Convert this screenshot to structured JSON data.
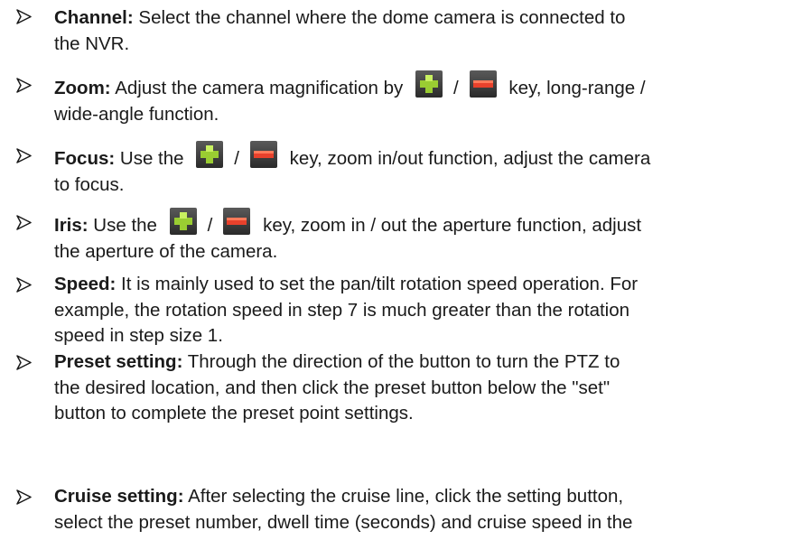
{
  "items": [
    {
      "label": "Channel:",
      "line1": " Select the channel where the dome camera is connected to",
      "line2": "the NVR."
    },
    {
      "label": "Zoom:",
      "pre": " Adjust the camera magnification by",
      "sep": "/",
      "post": "key, long-range /",
      "line2": "wide-angle function."
    },
    {
      "label": "Focus:",
      "pre": " Use the",
      "sep": "/",
      "post": "key, zoom in/out function, adjust the camera",
      "line2": "to focus."
    },
    {
      "label": "Iris:",
      "pre": " Use the",
      "sep": "/",
      "post": "key, zoom in / out the aperture function, adjust",
      "line2": "the aperture of the camera."
    },
    {
      "label": "Speed:",
      "line1": " It is mainly used to set the pan/tilt rotation speed operation. For",
      "line2": "example, the rotation speed in step 7 is much greater than the rotation",
      "line3": "speed in step size 1."
    },
    {
      "label": "Preset setting:",
      "line1": " Through the direction of the button to turn the PTZ to",
      "line2": "the desired location, and then click the preset button below the \"set\"",
      "line3": "button to complete the preset point settings."
    },
    {
      "label": "Cruise setting:",
      "line1": "  After selecting the cruise line, click the setting button,",
      "line2": "select the preset number, dwell time (seconds) and cruise speed in the"
    }
  ],
  "icons": {
    "plus": "plus-key-icon",
    "minus": "minus-key-icon"
  }
}
